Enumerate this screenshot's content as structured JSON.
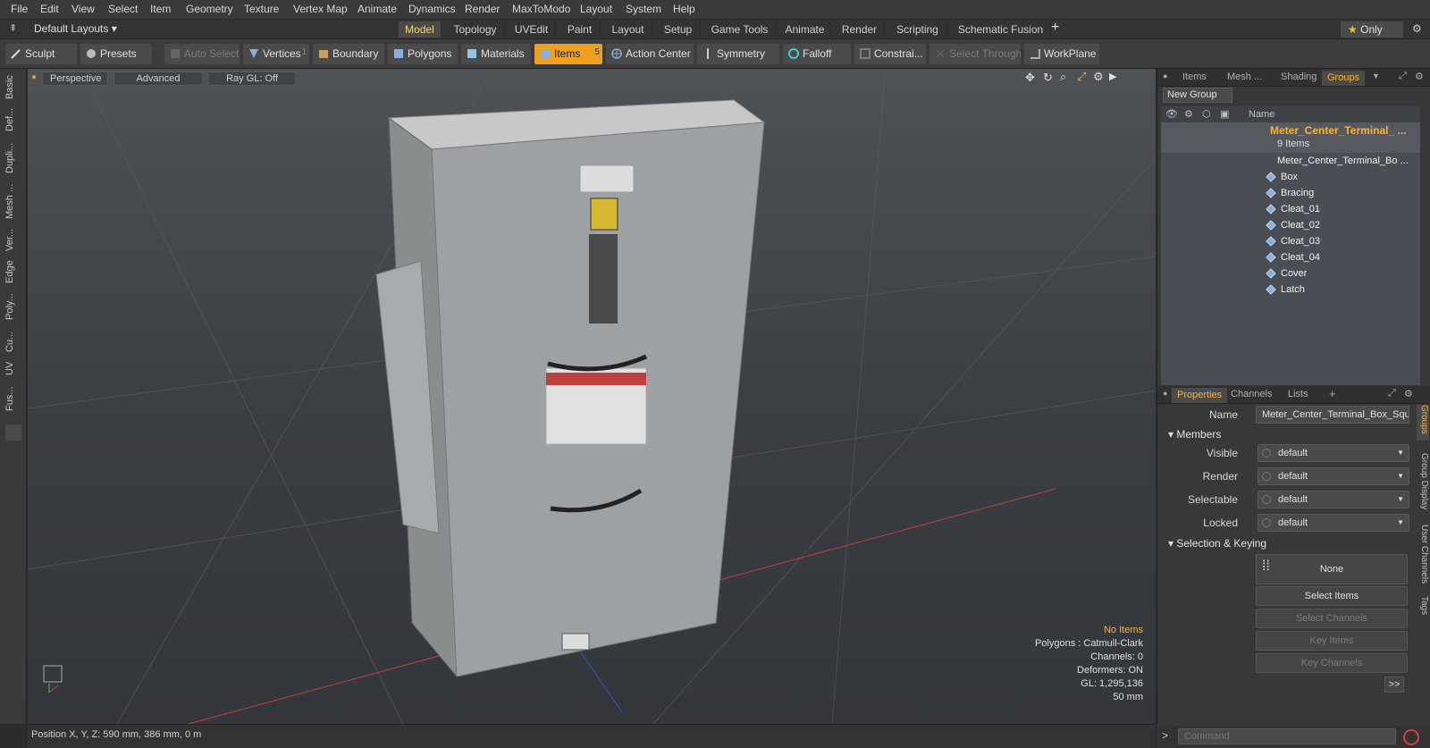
{
  "menu": [
    "File",
    "Edit",
    "View",
    "Select",
    "Item",
    "Geometry",
    "Texture",
    "Vertex Map",
    "Animate",
    "Dynamics",
    "Render",
    "MaxToModo",
    "Layout",
    "System",
    "Help"
  ],
  "layout_selector": "Default Layouts",
  "layout_tabs": [
    "Model",
    "Topology",
    "UVEdit",
    "Paint",
    "Layout",
    "Setup",
    "Game Tools",
    "Animate",
    "Render",
    "Scripting",
    "Schematic Fusion"
  ],
  "only_label": "Only",
  "toolbar": {
    "sculpt": "Sculpt",
    "presets": "Presets",
    "auto_select": "Auto Select",
    "vertices": "Vertices",
    "vertices_count": "1",
    "boundary": "Boundary",
    "polygons": "Polygons",
    "materials": "Materials",
    "items": "Items",
    "items_count": "5",
    "action_center": "Action Center",
    "symmetry": "Symmetry",
    "falloff": "Falloff",
    "constraints": "Constrai...",
    "select_through": "Select Through",
    "workplane": "WorkPlane"
  },
  "left_tabs": [
    "Basic",
    "Def...",
    "Dupli...",
    "Mesh ...",
    "Ver...",
    "Edge",
    "Poly...",
    "Cu...",
    "UV",
    "Fus..."
  ],
  "viewport": {
    "perspective": "Perspective",
    "advanced": "Advanced",
    "raygl": "Ray GL: Off",
    "info": {
      "selection": "No Items",
      "polygons": "Polygons : Catmull-Clark",
      "channels": "Channels: 0",
      "deformers": "Deformers: ON",
      "gl": "GL: 1,295,136",
      "scale": "50 mm"
    }
  },
  "status": "Position X, Y, Z:  590 mm, 386 mm, 0 m",
  "groups_panel": {
    "tabs": [
      "Items",
      "Mesh ...",
      "Shading",
      "Groups"
    ],
    "new_group": "New Group",
    "name_header": "Name",
    "group_name": "Meter_Center_Terminal_ ...",
    "group_count": "9 Items",
    "items": [
      "Meter_Center_Terminal_Bo ...",
      "Box",
      "Bracing",
      "Cleat_01",
      "Cleat_02",
      "Cleat_03",
      "Cleat_04",
      "Cover",
      "Latch"
    ]
  },
  "properties_panel": {
    "tabs": [
      "Properties",
      "Channels",
      "Lists"
    ],
    "name_label": "Name",
    "name_value": "Meter_Center_Terminal_Box_Squ",
    "members_label": "Members",
    "visible_label": "Visible",
    "render_label": "Render",
    "selectable_label": "Selectable",
    "locked_label": "Locked",
    "dropdown_value": "default",
    "selection_keying_label": "Selection & Keying",
    "none_label": "None",
    "select_items": "Select Items",
    "select_channels": "Select Channels",
    "key_items": "Key Items",
    "key_channels": "Key Channels",
    "more": ">>",
    "side_tabs": [
      "Groups",
      "Group Display",
      "User Channels",
      "Tags"
    ]
  },
  "command_placeholder": "Command"
}
